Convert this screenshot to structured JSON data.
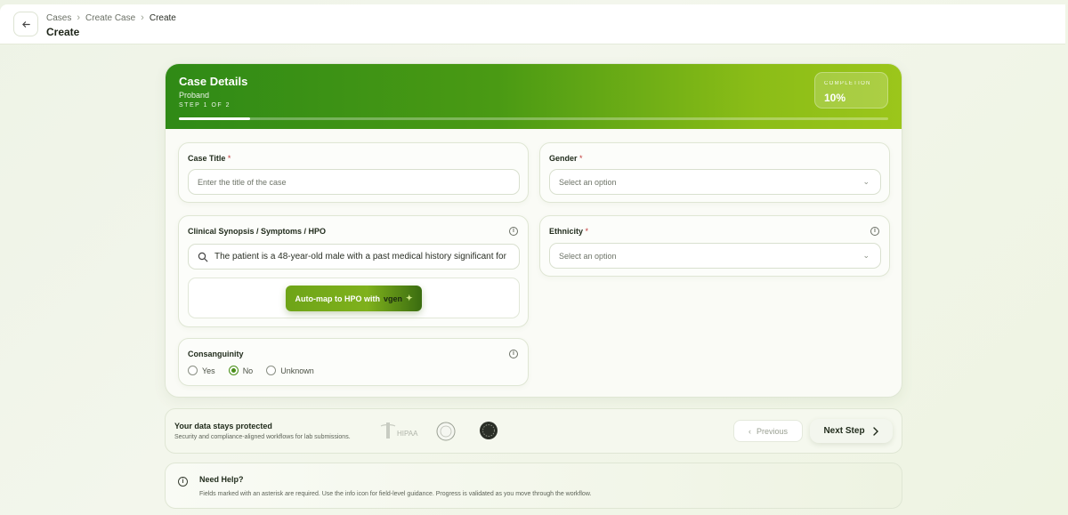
{
  "header": {
    "breadcrumbs": [
      "Cases",
      "Create Case",
      "Create"
    ],
    "title": "Create"
  },
  "card": {
    "title": "Case Details",
    "subtitle": "Proband",
    "step": "STEP 1 OF 2",
    "progress_fraction": 0.1,
    "completion_label": "COMPLETION",
    "completion_value": "10%"
  },
  "form": {
    "case_title": {
      "label": "Case Title",
      "required": "*",
      "placeholder": "Enter the title of the case"
    },
    "gender": {
      "label": "Gender",
      "required": "*",
      "placeholder": "Select an option"
    },
    "clinical": {
      "label": "Clinical Synopsis / Symptoms / HPO",
      "value": "The patient is a 48-year-old male with a past medical history significant for",
      "automap_label": "Auto-map to HPO with",
      "automap_brand": "vgen"
    },
    "ethnicity": {
      "label": "Ethnicity",
      "required": "*",
      "placeholder": "Select an option"
    },
    "consanguinity": {
      "label": "Consanguinity",
      "options": [
        "Yes",
        "No",
        "Unknown"
      ],
      "selected": "No"
    }
  },
  "footer": {
    "protect_title": "Your data stays protected",
    "protect_sub": "Security and compliance-aligned workflows for lab submissions.",
    "hipaa": "HIPAA",
    "previous": "Previous",
    "next": "Next Step"
  },
  "help": {
    "title": "Need Help?",
    "text": "Fields marked with an asterisk are required. Use the info icon for field-level guidance. Progress is validated as you move through the workflow."
  },
  "colors": {
    "accent": "#4a8f19",
    "header_start": "#2f8a16",
    "header_end": "#9cc61b"
  }
}
